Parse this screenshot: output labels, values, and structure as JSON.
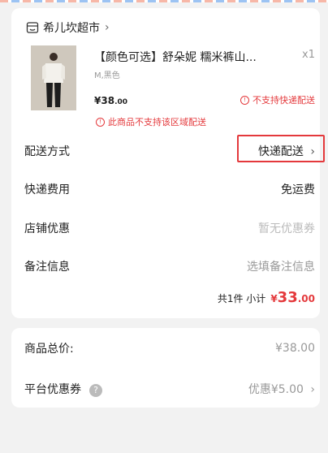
{
  "shop": {
    "name": "希儿坎超市",
    "chevron": "›"
  },
  "product": {
    "title": "【颜色可选】舒朵妮 糯米裤山...",
    "quantity": "x1",
    "spec": "M,黑色",
    "price_int": "¥38",
    "price_dec": ".00",
    "warning_express": "不支持快递配送",
    "warning_region": "此商品不支持该区域配送"
  },
  "delivery": {
    "method_label": "配送方式",
    "method_value": "快递配送",
    "fee_label": "快递费用",
    "fee_value": "免运费",
    "coupon_label": "店铺优惠",
    "coupon_value": "暂无优惠券",
    "note_label": "备注信息",
    "note_placeholder": "选填备注信息"
  },
  "subtotal": {
    "count_text": "共1件 小计",
    "currency": "¥",
    "amount_int": "33",
    "amount_dec": ".00"
  },
  "summary": {
    "total_label": "商品总价:",
    "total_value": "¥38.00",
    "platform_label": "平台优惠券",
    "platform_value": "优惠¥5.00",
    "help_icon": "?"
  },
  "colors": {
    "accent": "#e4393c",
    "background": "#f2f2f2"
  }
}
